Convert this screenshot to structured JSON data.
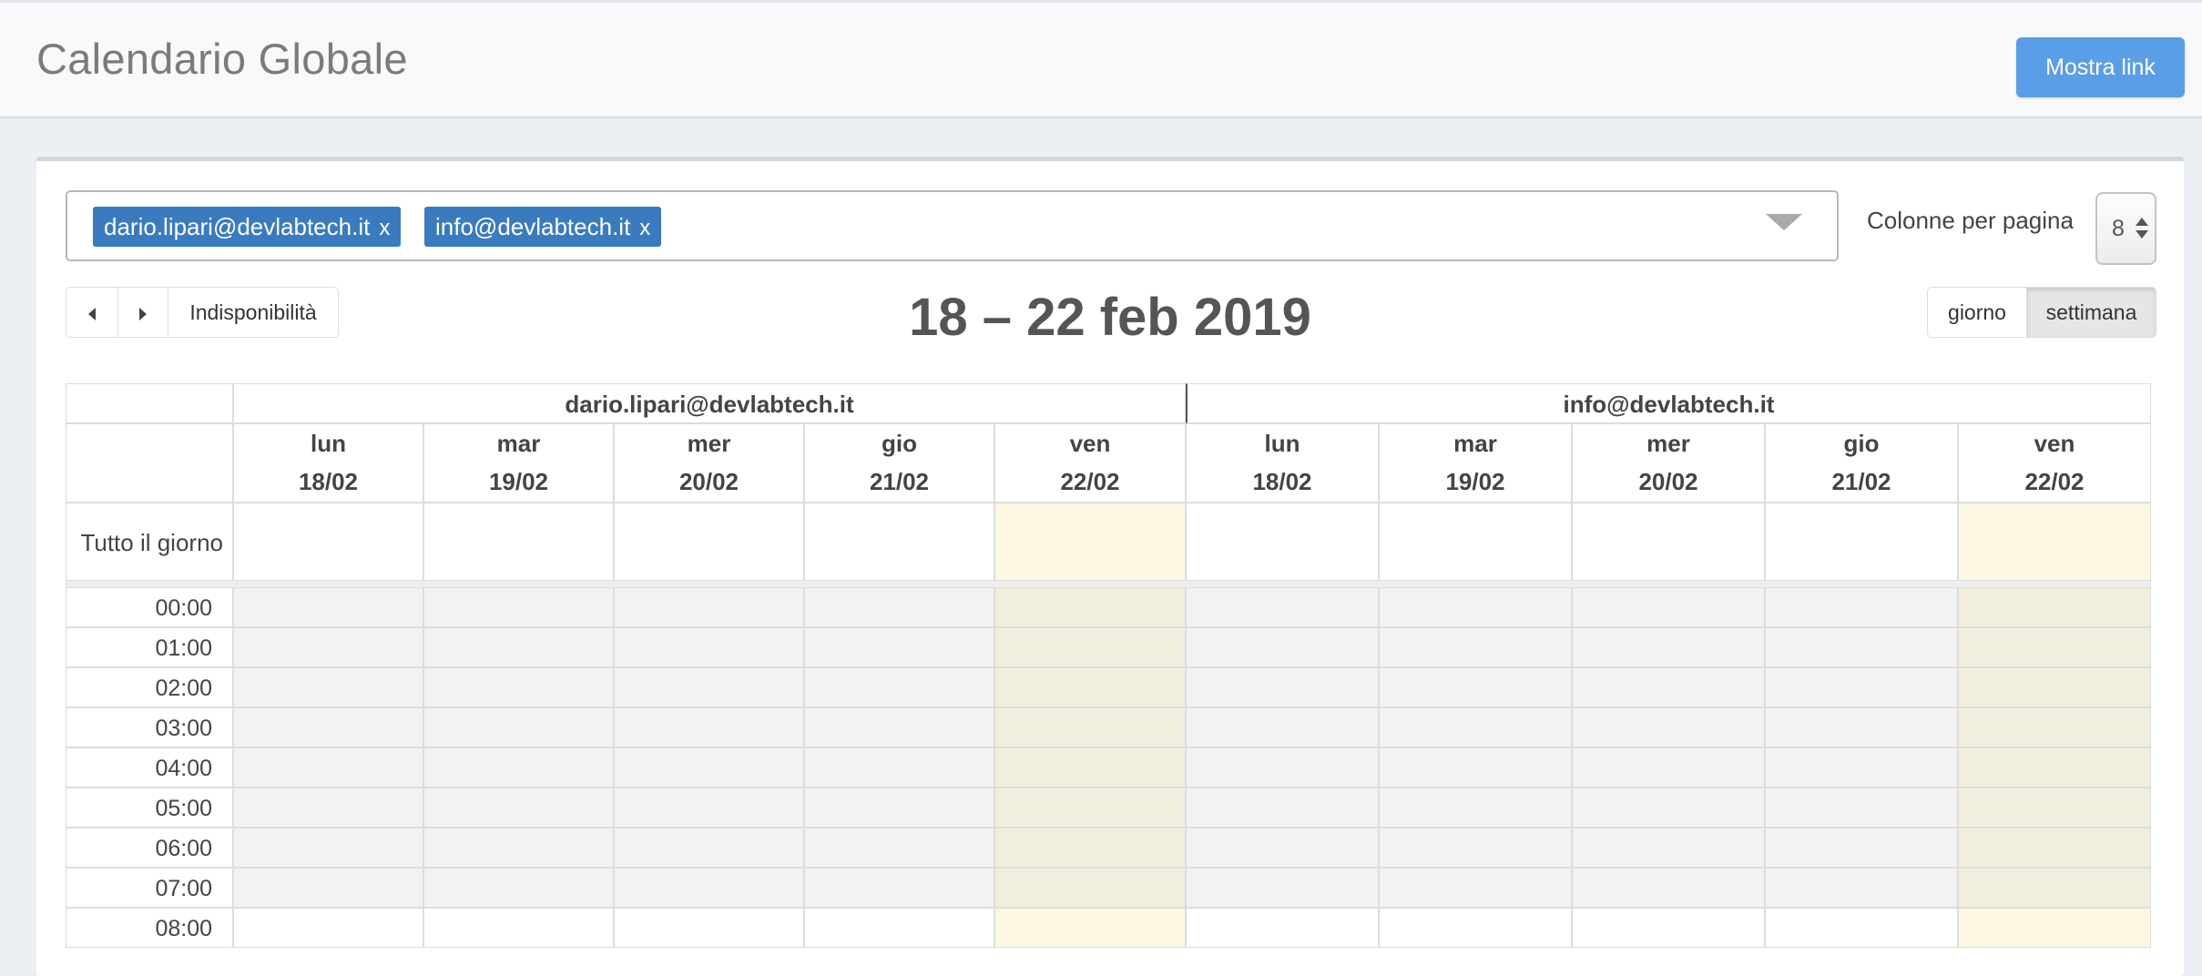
{
  "header": {
    "title": "Calendario Globale",
    "show_link_label": "Mostra link"
  },
  "filters": {
    "selected_users": [
      {
        "label": "dario.lipari@devlabtech.it",
        "remove": "x"
      },
      {
        "label": "info@devlabtech.it",
        "remove": "x"
      }
    ],
    "columns_per_page_label": "Colonne per pagina",
    "columns_per_page_value": "8"
  },
  "toolbar": {
    "unavailability_label": "Indisponibilità",
    "range_title": "18 – 22 feb 2019",
    "view_day_label": "giorno",
    "view_week_label": "settimana",
    "active_view": "settimana"
  },
  "calendar": {
    "users": [
      "dario.lipari@devlabtech.it",
      "info@devlabtech.it"
    ],
    "days": [
      {
        "dow": "lun",
        "date": "18/02",
        "today": false
      },
      {
        "dow": "mar",
        "date": "19/02",
        "today": false
      },
      {
        "dow": "mer",
        "date": "20/02",
        "today": false
      },
      {
        "dow": "gio",
        "date": "21/02",
        "today": false
      },
      {
        "dow": "ven",
        "date": "22/02",
        "today": true
      }
    ],
    "all_day_label": "Tutto il giorno",
    "hours": [
      "00:00",
      "01:00",
      "02:00",
      "03:00",
      "04:00",
      "05:00",
      "06:00",
      "07:00",
      "08:00"
    ],
    "unavailable_hours": [
      "00:00",
      "01:00",
      "02:00",
      "03:00",
      "04:00",
      "05:00",
      "06:00",
      "07:00"
    ],
    "colors": {
      "today_bg": "#fcf8e3",
      "unavailable_bg": "#f2f2f2",
      "unavailable_today_bg": "#f1eedd",
      "border": "#dddddd"
    }
  }
}
